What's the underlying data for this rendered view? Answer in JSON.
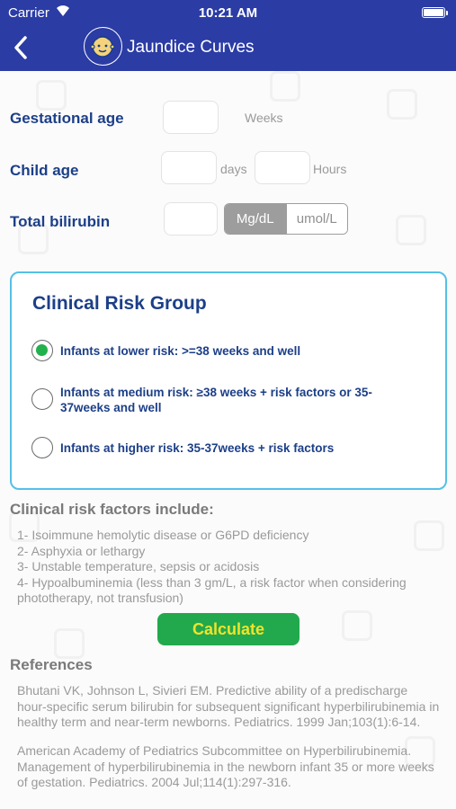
{
  "status_bar": {
    "carrier": "Carrier",
    "time": "10:21 AM"
  },
  "nav": {
    "title": "Jaundice Curves",
    "back_icon": "chevron-left-icon",
    "logo_icon": "baby-face-icon"
  },
  "form": {
    "gestational_age": {
      "label": "Gestational age",
      "value": "",
      "unit": "Weeks"
    },
    "child_age": {
      "label": "Child age",
      "days_value": "",
      "days_unit": "days",
      "hours_value": "",
      "hours_unit": "Hours"
    },
    "total_bilirubin": {
      "label": "Total bilirubin",
      "value": "",
      "units": [
        "Mg/dL",
        "umol/L"
      ],
      "selected_unit": "Mg/dL"
    }
  },
  "risk_group": {
    "title": "Clinical Risk Group",
    "options": [
      {
        "label": "Infants at lower risk: >=38 weeks and well",
        "selected": true
      },
      {
        "label": "Infants at medium risk: ≥38 weeks + risk factors or 35-37weeks and well",
        "selected": false
      },
      {
        "label": "Infants at higher risk: 35-37weeks + risk factors",
        "selected": false
      }
    ]
  },
  "risk_factors": {
    "heading": "Clinical risk factors include:",
    "items": [
      "1- Isoimmune hemolytic disease or G6PD deficiency",
      "2- Asphyxia or lethargy",
      "3- Unstable temperature, sepsis or acidosis",
      "4- Hypoalbuminemia (less than 3 gm/L, a risk factor when considering phototherapy, not transfusion)"
    ]
  },
  "calculate_label": "Calculate",
  "references": {
    "heading": "References",
    "items": [
      "Bhutani VK, Johnson L, Sivieri EM. Predictive ability of a predischarge hour-specific serum bilirubin for subsequent significant hyperbilirubinemia in healthy term and near-term newborns. Pediatrics. 1999 Jan;103(1):6-14.",
      "American Academy of Pediatrics Subcommittee on Hyperbilirubinemia. Management of hyperbilirubinemia in the newborn infant 35 or more weeks of gestation. Pediatrics. 2004 Jul;114(1):297-316."
    ]
  },
  "colors": {
    "nav_bg": "#2b3ca5",
    "label_blue": "#1c3f88",
    "card_border": "#54c0e6",
    "radio_selected": "#22b14c",
    "button_bg": "#22a94d",
    "button_text": "#f1e32b"
  }
}
